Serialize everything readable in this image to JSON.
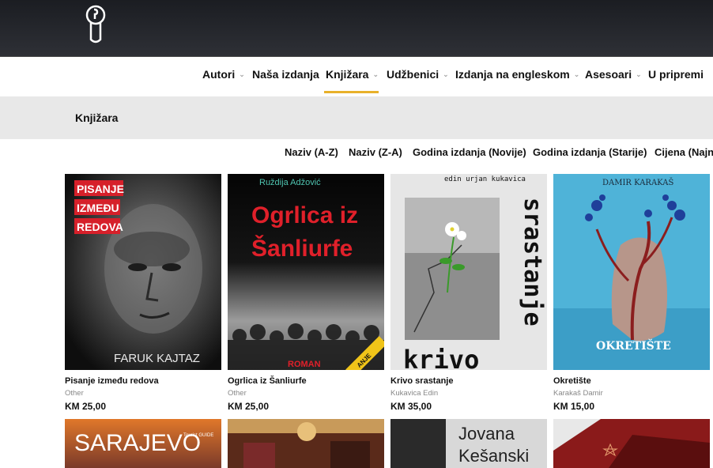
{
  "nav": {
    "items": [
      {
        "label": "Autori",
        "dropdown": true
      },
      {
        "label": "Naša izdanja",
        "dropdown": false
      },
      {
        "label": "Knjižara",
        "dropdown": true,
        "active": true
      },
      {
        "label": "Udžbenici",
        "dropdown": true
      },
      {
        "label": "Izdanja na engleskom",
        "dropdown": true
      },
      {
        "label": "Asesoari",
        "dropdown": true
      },
      {
        "label": "U pripremi",
        "dropdown": false
      }
    ],
    "chevron": "⌄",
    "accent_color": "#e8b12a"
  },
  "page": {
    "title": "Knjižara"
  },
  "sort": {
    "options": [
      "Naziv (A-Z)",
      "Naziv (Z-A)",
      "Godina izdanja (Novije)",
      "Godina izdanja (Starije)",
      "Cijena (Najn"
    ]
  },
  "products": [
    {
      "title": "Pisanje između redova",
      "author": "Other",
      "price": "KM 25,00",
      "cover": {
        "lines": [
          "PISANJE",
          "IZMEĐU",
          "REDOVA"
        ],
        "author_text": "FARUK KAJTAZ",
        "badge_color": "#d6202a"
      }
    },
    {
      "title": "Ogrlica iz Šanliurfe",
      "author": "Other",
      "price": "KM 25,00",
      "cover": {
        "top_author": "Ruždija Adžović",
        "lines": [
          "Ogrlica iz",
          "Šanliurfe"
        ],
        "footer": "ROMAN",
        "corner": "ANJE",
        "title_color": "#e0202a"
      }
    },
    {
      "title": "Krivo srastanje",
      "author": "Kukavica Edin",
      "price": "KM 35,00",
      "cover": {
        "top_author": "edin urjan kukavica",
        "side": "srastanje",
        "bottom": "krivo"
      }
    },
    {
      "title": "Okretište",
      "author": "Karakaš Damir",
      "price": "KM 15,00",
      "cover": {
        "top_author": "DAMIR KARAKAŠ",
        "title_text": "OKRETIŠTE",
        "bg_color": "#4fb3d8"
      }
    }
  ],
  "products_row2": [
    {
      "cover_text": "SARAJEVO",
      "badge": "Tourist GUIDE"
    },
    {
      "cover_text": ""
    },
    {
      "cover_lines": [
        "Jovana",
        "Kešanski"
      ]
    },
    {
      "cover_text": ""
    }
  ]
}
